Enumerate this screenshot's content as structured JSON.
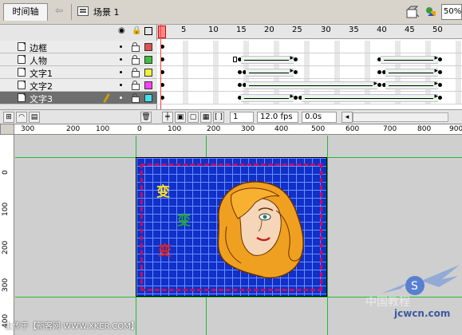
{
  "toolbar": {
    "timeline_tab": "时间轴",
    "scene_label": "场景 1",
    "zoom": "50%"
  },
  "timeline": {
    "frame_numbers": [
      "1",
      "5",
      "10",
      "15",
      "20",
      "25",
      "30",
      "35",
      "40",
      "45",
      "50"
    ],
    "layers": [
      {
        "name": "边框",
        "color": "#e05050",
        "active": false
      },
      {
        "name": "人物",
        "color": "#40c040",
        "active": false
      },
      {
        "name": "文字1",
        "color": "#f0f040",
        "active": false
      },
      {
        "name": "文字2",
        "color": "#ff40ff",
        "active": false
      },
      {
        "name": "文字3",
        "color": "#40e0f0",
        "active": true
      }
    ],
    "footer": {
      "current_frame": "1",
      "fps": "12.0 fps",
      "time": "0.0s"
    }
  },
  "ruler": {
    "h_labels": [
      "300",
      "200",
      "100",
      "0",
      "100",
      "200",
      "300",
      "400",
      "500",
      "600",
      "700",
      "800",
      "900"
    ],
    "v_labels": [
      "0",
      "100",
      "200",
      "300",
      "400"
    ]
  },
  "stage": {
    "text_chars": [
      {
        "char": "变",
        "color": "#ffe020"
      },
      {
        "char": "变",
        "color": "#20a040"
      },
      {
        "char": "变",
        "color": "#e02020"
      }
    ]
  },
  "status_text": "上传于【新客网 WWW.XKER.COM】",
  "watermark": {
    "brand": "中国教程",
    "site": "jcwcn.com"
  },
  "colors": {
    "stage_bg": "#1030c8",
    "border": "#c01060",
    "guide": "#22bb33"
  }
}
